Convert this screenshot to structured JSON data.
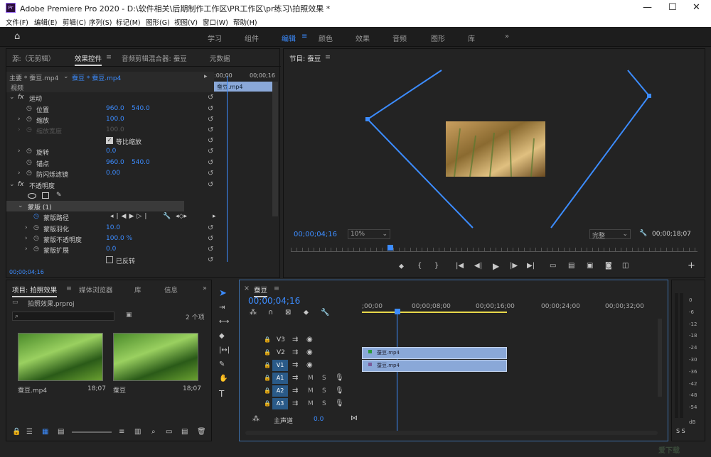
{
  "app": {
    "title": "Adobe Premiere Pro 2020 - D:\\软件相关\\后期制作工作区\\PR工作区\\pr练习\\拍照效果 *",
    "logo": "Pr"
  },
  "window_controls": {
    "minimize": "—",
    "maximize": "☐",
    "close": "✕"
  },
  "menu": [
    "文件(F)",
    "编辑(E)",
    "剪辑(C)",
    "序列(S)",
    "标记(M)",
    "图形(G)",
    "视图(V)",
    "窗口(W)",
    "帮助(H)"
  ],
  "workspaces": [
    "学习",
    "组件",
    "编辑",
    "颜色",
    "效果",
    "音频",
    "图形",
    "库"
  ],
  "workspace_active": "编辑",
  "source_panel": {
    "tabs": [
      "源:（无剪辑）",
      "效果控件",
      "音频剪辑混合器: 蚕豆",
      "元数据"
    ],
    "active": "效果控件"
  },
  "effect_controls": {
    "master": "主要 * 蚕豆.mp4",
    "seq": "蚕豆 * 蚕豆.mp4",
    "ruler": [
      ":00;00",
      "00;00;16"
    ],
    "clip_name": "蚕豆.mp4",
    "video_label": "视频",
    "motion": "运动",
    "position": "位置",
    "position_x": "960.0",
    "position_y": "540.0",
    "scale": "缩放",
    "scale_val": "100.0",
    "scale_width": "缩放宽度",
    "uniform": "等比缩放",
    "rotation": "旋转",
    "rotation_val": "0.0",
    "anchor": "锚点",
    "anchor_x": "960.0",
    "anchor_y": "540.0",
    "flicker": "防闪烁滤镜",
    "flicker_val": "0.00",
    "opacity": "不透明度",
    "mask": "蒙版 (1)",
    "mask_path": "蒙版路径",
    "mask_feather": "蒙版羽化",
    "mask_feather_val": "10.0",
    "mask_opacity": "蒙版不透明度",
    "mask_opacity_val": "100.0 %",
    "mask_expansion": "蒙版扩展",
    "mask_expansion_val": "0.0",
    "inverted": "已反转",
    "timecode": "00;00;04;16"
  },
  "program": {
    "title": "节目: 蚕豆",
    "timecode": "00;00;04;16",
    "zoom": "10%",
    "quality": "完整",
    "duration": "00;00;18;07"
  },
  "project": {
    "tabs": [
      "项目: 拍照效果",
      "媒体浏览器",
      "库",
      "信息"
    ],
    "file": "拍照效果.prproj",
    "count": "2 个项",
    "items": [
      {
        "name": "蚕豆.mp4",
        "dur": "18;07"
      },
      {
        "name": "蚕豆",
        "dur": "18;07"
      }
    ]
  },
  "timeline": {
    "title": "蚕豆",
    "timecode": "00;00;04;16",
    "ruler": [
      ";00;00",
      "00;00;08;00",
      "00;00;16;00",
      "00;00;24;00",
      "00;00;32;00"
    ],
    "tracks": [
      {
        "label": "V3",
        "tag": ""
      },
      {
        "label": "V2",
        "tag": ""
      },
      {
        "label": "V1",
        "tag": "V1"
      },
      {
        "label": "A1",
        "tag": "A1"
      },
      {
        "label": "A2",
        "tag": "A2"
      },
      {
        "label": "A3",
        "tag": "A3"
      }
    ],
    "mute": "M",
    "solo": "S",
    "master": "主声道",
    "master_val": "0.0",
    "clips": [
      {
        "name": "蚕豆.mp4"
      },
      {
        "name": "蚕豆.mp4"
      }
    ]
  },
  "meter": {
    "scale": [
      "0",
      "-6",
      "-12",
      "-18",
      "-24",
      "-30",
      "-36",
      "-42",
      "-48",
      "-54",
      "dB"
    ],
    "solo": "S S"
  },
  "watermark": "爱下载"
}
